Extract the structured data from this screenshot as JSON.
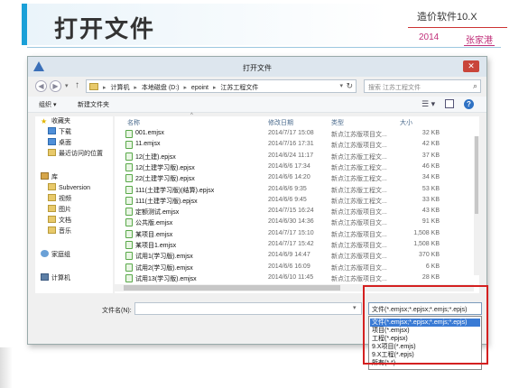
{
  "slide": {
    "title": "打开文件",
    "brand": "造价软件10.X",
    "year": "2014",
    "author": "张家港"
  },
  "window": {
    "title": "打开文件",
    "close_label": "✕"
  },
  "address": {
    "crumbs": [
      "计算机",
      "本地磁盘 (D:)",
      "epoint",
      "江苏工程文件"
    ],
    "search_placeholder": "搜索 江苏工程文件"
  },
  "toolbar": {
    "organize": "组织 ▾",
    "new_folder": "新建文件夹"
  },
  "navpane": {
    "items": [
      {
        "label": "收藏夹",
        "icon": "star-icon"
      },
      {
        "label": "下载",
        "icon": "folder-icon"
      },
      {
        "label": "桌面",
        "icon": "folder-icon"
      },
      {
        "label": "最近访问的位置",
        "icon": "folder-icon"
      },
      {
        "label": "库",
        "icon": "library-icon"
      },
      {
        "label": "Subversion",
        "icon": "folder-icon"
      },
      {
        "label": "视频",
        "icon": "folder-icon"
      },
      {
        "label": "图片",
        "icon": "folder-icon"
      },
      {
        "label": "文档",
        "icon": "folder-icon"
      },
      {
        "label": "音乐",
        "icon": "folder-icon"
      },
      {
        "label": "家庭组",
        "icon": "homegroup-icon"
      },
      {
        "label": "计算机",
        "icon": "computer-icon"
      }
    ]
  },
  "filelist": {
    "columns": [
      "名称",
      "修改日期",
      "类型",
      "大小"
    ],
    "rows": [
      {
        "name": "001.emjsx",
        "date": "2014/7/17 15:08",
        "type": "新点江苏版项目文...",
        "size": "32 KB"
      },
      {
        "name": "11.emjsx",
        "date": "2014/7/16 17:31",
        "type": "新点江苏版项目文...",
        "size": "42 KB"
      },
      {
        "name": "12(土建).epjsx",
        "date": "2014/6/24 11:17",
        "type": "新点江苏版工程文...",
        "size": "37 KB"
      },
      {
        "name": "12(土建学习版).epjsx",
        "date": "2014/6/6 17:34",
        "type": "新点江苏版工程文...",
        "size": "46 KB"
      },
      {
        "name": "22(土建学习版).epjsx",
        "date": "2014/6/6 14:20",
        "type": "新点江苏版工程文...",
        "size": "34 KB"
      },
      {
        "name": "111(土建学习版)(结算).epjsx",
        "date": "2014/6/6 9:35",
        "type": "新点江苏版工程文...",
        "size": "53 KB"
      },
      {
        "name": "111(土建学习版).epjsx",
        "date": "2014/6/6 9:45",
        "type": "新点江苏版工程文...",
        "size": "33 KB"
      },
      {
        "name": "定额测试.emjsx",
        "date": "2014/7/15 16:24",
        "type": "新点江苏版项目文...",
        "size": "43 KB"
      },
      {
        "name": "公共版.emjsx",
        "date": "2014/6/30 14:36",
        "type": "新点江苏版项目文...",
        "size": "91 KB"
      },
      {
        "name": "某项目.emjsx",
        "date": "2014/7/17 15:10",
        "type": "新点江苏版项目文...",
        "size": "1,508 KB"
      },
      {
        "name": "某项目1.emjsx",
        "date": "2014/7/17 15:42",
        "type": "新点江苏版项目文...",
        "size": "1,508 KB"
      },
      {
        "name": "试用1(学习版).emjsx",
        "date": "2014/6/9 14:47",
        "type": "新点江苏版项目文...",
        "size": "370 KB"
      },
      {
        "name": "试用2(学习版).emjsx",
        "date": "2014/6/6 16:09",
        "type": "新点江苏版项目文...",
        "size": "6 KB"
      },
      {
        "name": "试用13(学习版).emjsx",
        "date": "2014/6/10 11:45",
        "type": "新点江苏版项目文...",
        "size": "28 KB"
      }
    ]
  },
  "bottom": {
    "filename_label": "文件名(N):",
    "filename_value": "",
    "type_selected": "文件(*.emjsx;*.epjsx;*.emjs;*.epjs)",
    "type_options": [
      "文件(*.emjsx;*.epjsx;*.emjs;*.epjs)",
      "项目(*.emjsx)",
      "工程(*.epjsx)",
      "9.X项目(*.emjs)",
      "9.X工程(*.epjs)",
      "所有(*.*)"
    ]
  }
}
